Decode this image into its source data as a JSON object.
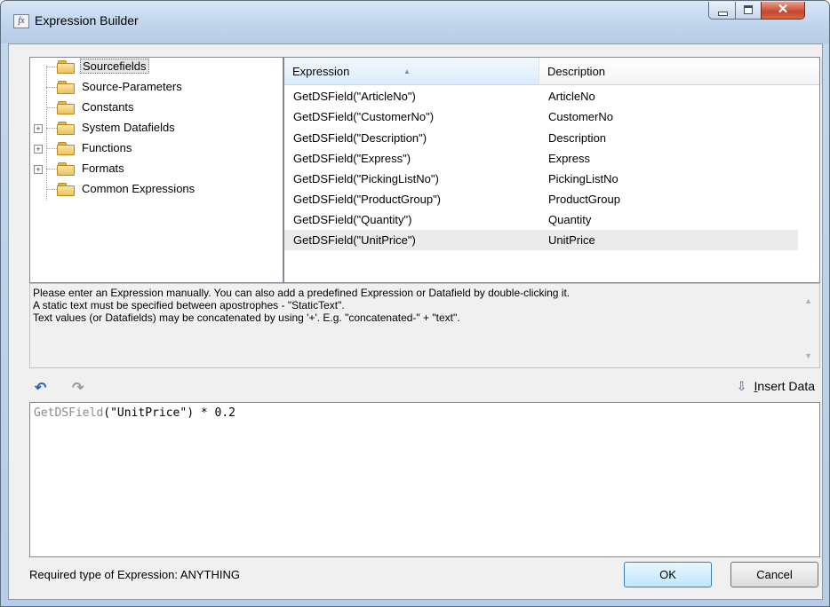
{
  "window": {
    "title": "Expression Builder",
    "title_icon_text": "fx"
  },
  "tree": {
    "items": [
      {
        "label": "Sourcefields",
        "selected": true,
        "expandable": false
      },
      {
        "label": "Source-Parameters",
        "selected": false,
        "expandable": false
      },
      {
        "label": "Constants",
        "selected": false,
        "expandable": false
      },
      {
        "label": "System Datafields",
        "selected": false,
        "expandable": true
      },
      {
        "label": "Functions",
        "selected": false,
        "expandable": true
      },
      {
        "label": "Formats",
        "selected": false,
        "expandable": true
      },
      {
        "label": "Common Expressions",
        "selected": false,
        "expandable": false
      }
    ]
  },
  "list": {
    "columns": {
      "expression": "Expression",
      "description": "Description"
    },
    "rows": [
      {
        "expression": "GetDSField(\"ArticleNo\")",
        "description": "ArticleNo"
      },
      {
        "expression": "GetDSField(\"CustomerNo\")",
        "description": "CustomerNo"
      },
      {
        "expression": "GetDSField(\"Description\")",
        "description": "Description"
      },
      {
        "expression": "GetDSField(\"Express\")",
        "description": "Express"
      },
      {
        "expression": "GetDSField(\"PickingListNo\")",
        "description": "PickingListNo"
      },
      {
        "expression": "GetDSField(\"ProductGroup\")",
        "description": "ProductGroup"
      },
      {
        "expression": "GetDSField(\"Quantity\")",
        "description": "Quantity"
      },
      {
        "expression": "GetDSField(\"UnitPrice\")",
        "description": "UnitPrice"
      }
    ]
  },
  "help": {
    "lines": [
      "Please enter an Expression manually. You can also add a predefined Expression or Datafield by double-clicking it.",
      "A static text must be specified between apostrophes - \"StaticText\".",
      "Text values (or Datafields) may be concatenated by using '+'. E.g. \"concatenated-\" + \"text\"."
    ]
  },
  "toolbar": {
    "insert_underlined": "I",
    "insert_rest": "nsert Data"
  },
  "editor": {
    "func": "GetDSField",
    "rest": "(\"UnitPrice\") * 0.2"
  },
  "footer": {
    "required_label": "Required type of Expression: ANYTHING",
    "ok_label": "OK",
    "cancel_label": "Cancel"
  }
}
